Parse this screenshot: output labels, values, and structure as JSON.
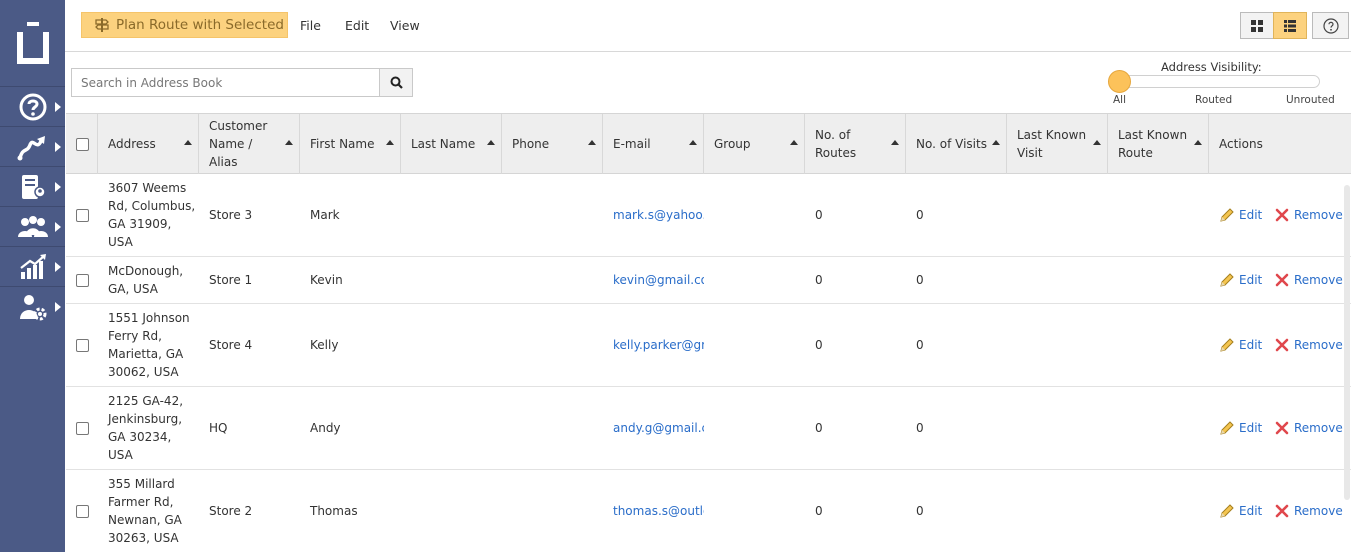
{
  "toolbar": {
    "plan_route_label": "Plan Route with Selected",
    "menu_file": "File",
    "menu_edit": "Edit",
    "menu_view": "View",
    "grid_view_icon": "grid-icon",
    "list_view_icon": "list-icon",
    "help_icon": "help-icon"
  },
  "sidebar": {
    "items": [
      {
        "icon": "help-circle-icon"
      },
      {
        "icon": "route-icon"
      },
      {
        "icon": "address-book-icon"
      },
      {
        "icon": "team-icon"
      },
      {
        "icon": "analytics-icon"
      },
      {
        "icon": "user-settings-icon"
      }
    ]
  },
  "search": {
    "placeholder": "Search in Address Book"
  },
  "visibility": {
    "title": "Address Visibility:",
    "options": [
      "All",
      "Routed",
      "Unrouted"
    ],
    "selected": "All"
  },
  "table": {
    "columns": [
      "Address",
      "Customer Name / Alias",
      "First Name",
      "Last Name",
      "Phone",
      "E-mail",
      "Group",
      "No. of Routes",
      "No. of Visits",
      "Last Known Visit",
      "Last Known Route",
      "Actions"
    ],
    "column_lines": {
      "customer": [
        "Customer",
        "Name /",
        "Alias"
      ],
      "routes": [
        "No. of",
        "Routes"
      ],
      "visit": [
        "Last Known",
        "Visit"
      ],
      "route": [
        "Last Known",
        "Route"
      ]
    },
    "edit_label": "Edit",
    "remove_label": "Remove",
    "rows": [
      {
        "address": [
          "3607 Weems",
          "Rd, Columbus,",
          "GA 31909,",
          "USA"
        ],
        "alias": "Store 3",
        "first": "Mark",
        "last": "",
        "phone": "",
        "email": "mark.s@yahoo.com",
        "group": "",
        "routes": "0",
        "visits": "0",
        "last_visit": "",
        "last_route": ""
      },
      {
        "address": [
          "McDonough,",
          "GA, USA"
        ],
        "alias": "Store 1",
        "first": "Kevin",
        "last": "",
        "phone": "",
        "email": "kevin@gmail.com",
        "group": "",
        "routes": "0",
        "visits": "0",
        "last_visit": "",
        "last_route": ""
      },
      {
        "address": [
          "1551 Johnson",
          "Ferry Rd,",
          "Marietta, GA",
          "30062, USA"
        ],
        "alias": "Store 4",
        "first": "Kelly",
        "last": "",
        "phone": "",
        "email": "kelly.parker@gmail.com",
        "group": "",
        "routes": "0",
        "visits": "0",
        "last_visit": "",
        "last_route": ""
      },
      {
        "address": [
          "2125 GA-42,",
          "Jenkinsburg,",
          "GA 30234,",
          "USA"
        ],
        "alias": "HQ",
        "first": "Andy",
        "last": "",
        "phone": "",
        "email": "andy.g@gmail.com",
        "group": "",
        "routes": "0",
        "visits": "0",
        "last_visit": "",
        "last_route": ""
      },
      {
        "address": [
          "355 Millard",
          "Farmer Rd,",
          "Newnan, GA",
          "30263, USA"
        ],
        "alias": "Store 2",
        "first": "Thomas",
        "last": "",
        "phone": "",
        "email": "thomas.s@outlook.com",
        "group": "",
        "routes": "0",
        "visits": "0",
        "last_visit": "",
        "last_route": ""
      }
    ]
  },
  "colors": {
    "sidebar": "#4b5a86",
    "accent": "#fcd27f",
    "link": "#2a6dc9",
    "remove_icon": "#e0474c"
  }
}
